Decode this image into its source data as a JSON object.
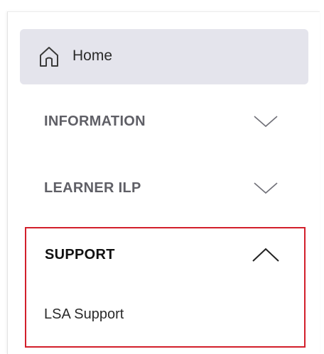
{
  "nav": {
    "home": {
      "label": "Home",
      "icon": "home-icon"
    },
    "sections": {
      "information": {
        "label": "INFORMATION",
        "icon": "chevron-down-icon",
        "expanded": false
      },
      "learner_ilp": {
        "label": "LEARNER ILP",
        "icon": "chevron-down-icon",
        "expanded": false
      },
      "support": {
        "label": "SUPPORT",
        "icon": "chevron-up-icon",
        "expanded": true,
        "items": [
          {
            "label": "LSA Support"
          }
        ]
      }
    }
  },
  "colors": {
    "home_bg": "#e4e4ec",
    "highlight_border": "#d21f2b",
    "muted_text": "#5f5f66",
    "active_text": "#111111"
  }
}
